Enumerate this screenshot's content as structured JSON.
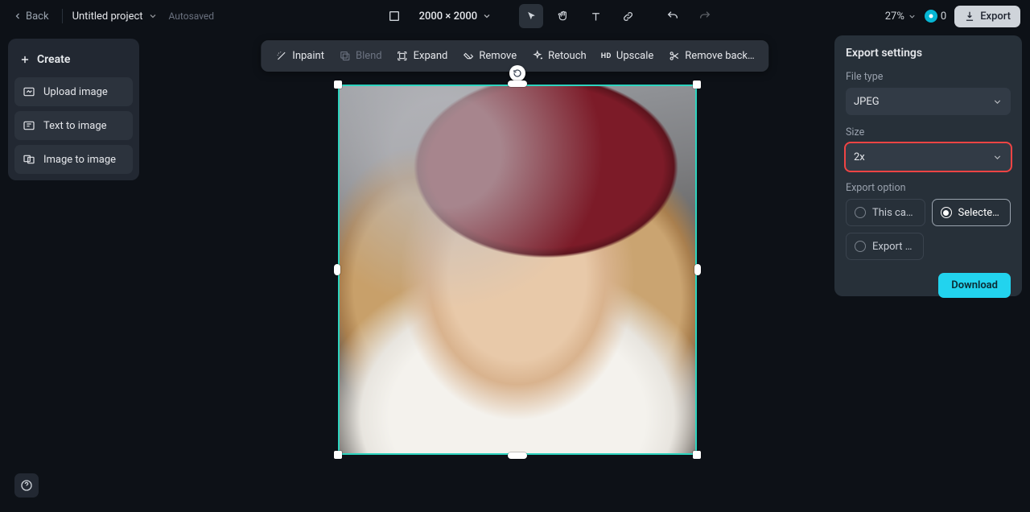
{
  "topbar": {
    "back": "Back",
    "project_name": "Untitled project",
    "autosaved": "Autosaved",
    "dimensions": "2000 × 2000",
    "zoom": "27%",
    "credits": "0",
    "export": "Export"
  },
  "left_panel": {
    "header": "Create",
    "upload": "Upload image",
    "text_to_image": "Text to image",
    "image_to_image": "Image to image"
  },
  "ai_toolbar": {
    "inpaint": "Inpaint",
    "blend": "Blend",
    "expand": "Expand",
    "remove": "Remove",
    "retouch": "Retouch",
    "upscale": "Upscale",
    "remove_bg": "Remove back…"
  },
  "export_panel": {
    "title": "Export settings",
    "file_type_label": "File type",
    "file_type_value": "JPEG",
    "size_label": "Size",
    "size_value": "2x",
    "export_option_label": "Export option",
    "option_this_canvas": "This canvas",
    "option_selected_layers": "Selected l…",
    "option_export_all": "Export all …",
    "download": "Download"
  }
}
